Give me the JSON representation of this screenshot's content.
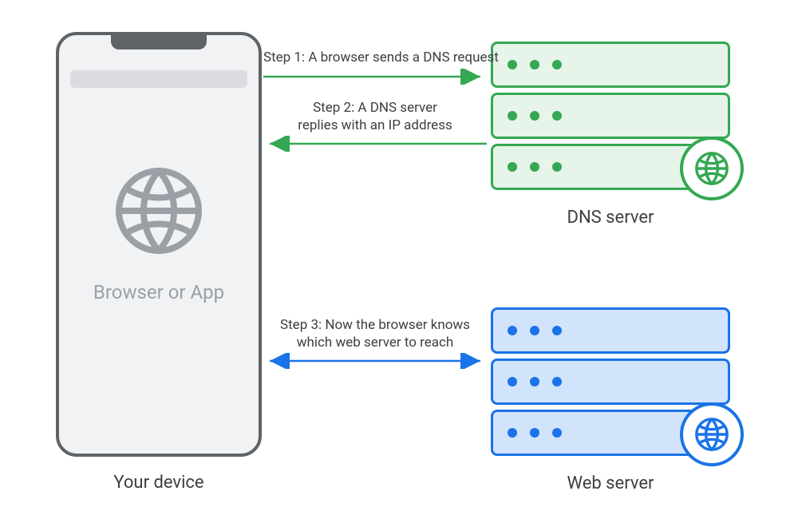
{
  "device_caption": "Your device",
  "device_inner_label": "Browser or App",
  "dns_server_caption": "DNS server",
  "web_server_caption": "Web server",
  "steps": {
    "s1": "Step 1: A browser sends a DNS request",
    "s2_line1": "Step 2: A DNS server",
    "s2_line2": "replies with an IP address",
    "s3_line1": "Step 3: Now the browser knows",
    "s3_line2": "which web server to reach"
  },
  "colors": {
    "phone_stroke": "#5f6368",
    "dns_green": "#34a853",
    "dns_fill": "#e6f4ea",
    "web_blue": "#1a73e8",
    "web_fill": "#d2e3fc"
  }
}
